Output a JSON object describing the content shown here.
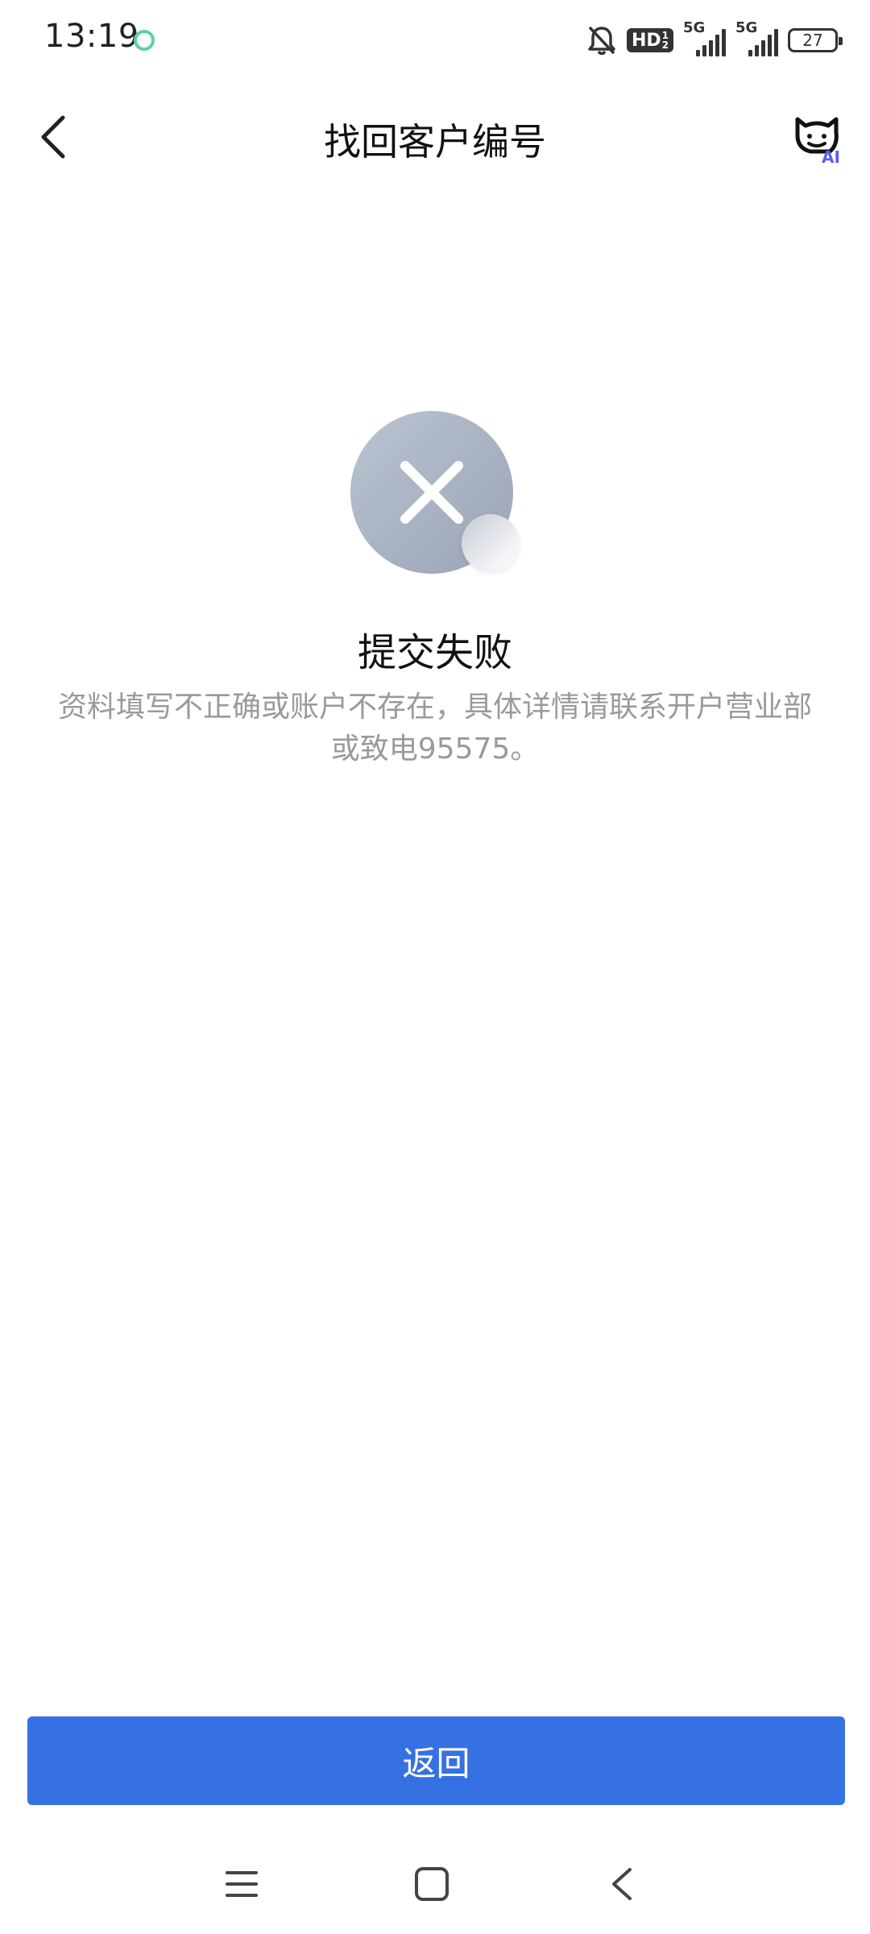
{
  "status_bar": {
    "time": "13:19",
    "hd_label": "HD",
    "hd_sub_top": "1",
    "hd_sub_bottom": "2",
    "signal1_label": "5G",
    "signal2_label": "5G",
    "battery_level": "27"
  },
  "header": {
    "title": "找回客户编号",
    "back_icon": "chevron-left-icon",
    "ai_icon": "ai-assistant-icon",
    "ai_label": "AI"
  },
  "result": {
    "icon": "failure-x-icon",
    "title": "提交失败",
    "description": "资料填写不正确或账户不存在，具体详情请联系开户营业部或致电95575。"
  },
  "actions": {
    "return_label": "返回"
  },
  "nav": {
    "menu_icon": "menu-icon",
    "home_icon": "home-icon",
    "back_icon": "back-icon"
  },
  "colors": {
    "primary": "#3671e3",
    "title_text": "#111111",
    "secondary_text": "#9a9a9a",
    "icon_gray": "#a3acbc"
  }
}
